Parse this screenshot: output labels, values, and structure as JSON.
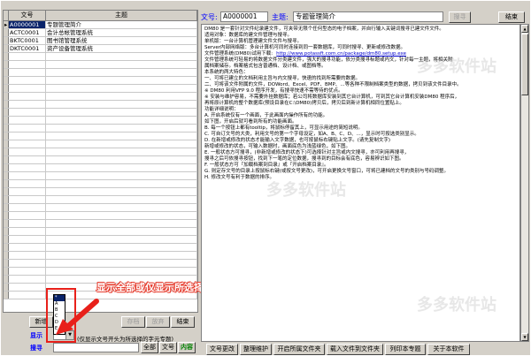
{
  "grid": {
    "col_code": "文号",
    "col_title": "主题",
    "rows": [
      {
        "code": "A0000001",
        "title": "专题管理简介",
        "selected": true
      },
      {
        "code": "ACTC0001",
        "title": "会计总帐管理系统",
        "selected": false
      },
      {
        "code": "BKTC0001",
        "title": "图书馆管理系统",
        "selected": false
      },
      {
        "code": "DKTC0001",
        "title": "资产设备管理系统",
        "selected": false
      }
    ],
    "empty_rows": 31
  },
  "left_buttons": {
    "new": "新增",
    "save": "存档",
    "abandon": "放弃",
    "end": "结束"
  },
  "left_controls": {
    "display_label": "显示",
    "search_label": "搜寻",
    "hint": "(仅显示文号开头为所选择的字元专题)",
    "all": "全部",
    "code": "文号",
    "theme": "主题",
    "content": "内容",
    "dropdown_options": [
      "*",
      "A",
      "B",
      "C",
      "D",
      "E"
    ]
  },
  "annotation": {
    "callout": "显示全部或仅显示所选择文号开头字符的专题"
  },
  "header": {
    "code_label": "文号:",
    "code_value": "A0000001",
    "theme_label": "主题:",
    "theme_value": "专题管理简介",
    "search_btn": "搜寻",
    "end_btn": "结束"
  },
  "document": {
    "lines": [
      "DM80 是一套针对文件纪录建文件，可夹带无限个任何型态的电子档案，并自行输入关键词搜寻已建文件文件。",
      "",
      "适用对象：数据库的建文件管理与搜寻。",
      "",
      "单机版：一台计算机管理建文件文件与搜寻。",
      "Server内部网络版：多台计算机可同时连接到同一套数据库，可同时搜寻、更新或修改数据。",
      "",
      "文件管理系统(DM80)试用下载:",
      "",
      "文件管理系统可轻易的将数据文件分类建文件，强大的搜寻功能，依分类搜寻标题或内文，针对每一主题，将相关附",
      "属档案储存。档案格式包含普通档、设计档、或图档等。",
      "",
      "本系统的两大特色：",
      "一、可将已建立的文档利用主旨与内文搜寻，快速的找到所需要的数据。",
      "二、可将该文件附属的文件，DOWord、Excel、PDF、BMP、...等各种不限制档案类型的数据，拷贝到该文件目录中。",
      "",
      "※ DM80 利用VFP 9.0 程序开发，有搜寻快速不需等待的优点。",
      "※ 安装与维护容易，不需要外挂数据库；若公司将数据库安装到其它台计算机，可到其它台计算机安装DM80 程序后，",
      "再将原计算机的整个数据库(预设目录在C:\\DM80)拷贝后，拷贝后到新计算机相同位置贴上。",
      "",
      "功能详细说明：",
      "A. 开启系统仅有一个画面，于此画面内操作所有的功能。",
      "如下图，开启后就可看到所有的功能画面。",
      "B. 每一个按钮上都有tooltip，将鼠标停留其上，可显示用途的简短说明。",
      "C. 可自订文号的大类，利用文号的第一个字母设定，如A、B、C、D、...，显示时可按选类别显示。",
      "D. 在新增或修改的状态才能输入文字数据，也可按鼠标右键贴上文字。(请先复制文字)",
      "新增或修改的状态，可输入数据时，画面底色为浅蓝绿色，如下图。",
      "E. 一般状态方可搜寻，(非新增或修改的状态下)可选择针对主旨或内文搜寻，亦可利用再搜寻，",
      "搜寻之后可依搜寻按钮，找到下一笔的定位数据，搜寻到的目标会有底色，容易辨识如下图。",
      "F. 一般状态方可『加载档案到目录』或『开启档案目录』。",
      "G. 则定存文号的目录上按鼠标右键(或按文号更改)，可开启更换文号窗口，可将已建档的文号的类别与号码调整。",
      "H. 修改文号有利于数据的排序。"
    ],
    "link_text": "http://www.potassft.com.cn/package/dm80.setup.exe"
  },
  "bottom_buttons": [
    "文号更改",
    "整理维护",
    "开启所属文件夹",
    "载入文件到文件夹",
    "列印本专题",
    "关于本软件"
  ],
  "watermark": "多多软件站"
}
